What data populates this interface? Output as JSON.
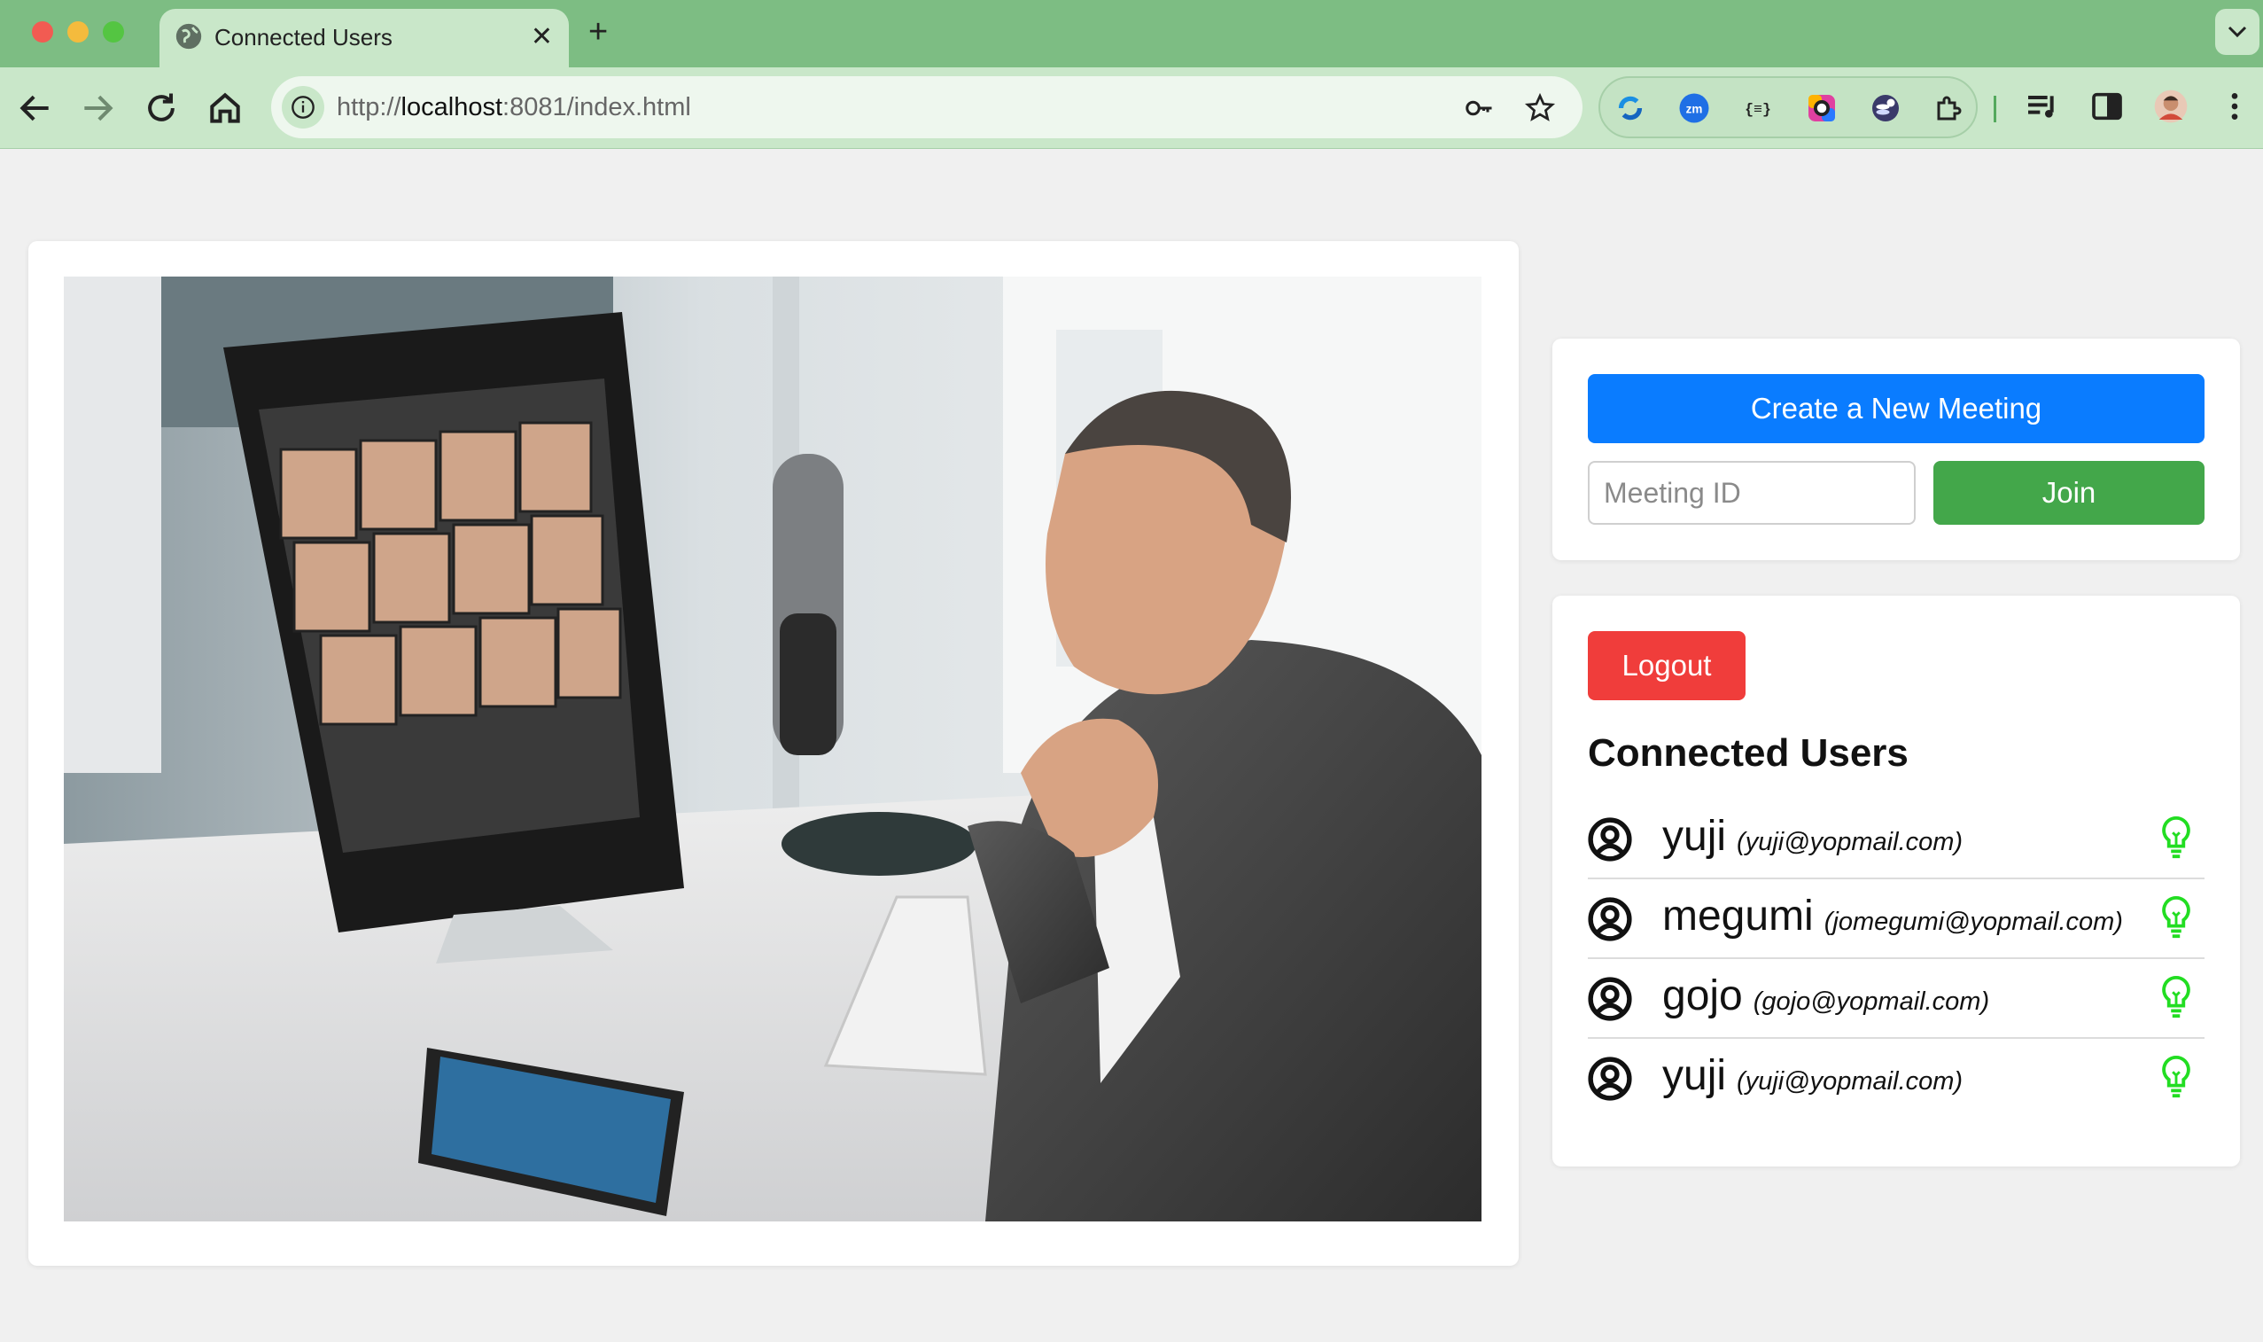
{
  "browser": {
    "tab_title": "Connected Users",
    "url_prefix": "http://",
    "url_host": "localhost",
    "url_rest": ":8081/index.html",
    "ext_zoom_label": "zm",
    "ext_json_label": "{≡}"
  },
  "meeting": {
    "create_label": "Create a New Meeting",
    "meeting_id_placeholder": "Meeting ID",
    "meeting_id_value": "",
    "join_label": "Join"
  },
  "users_panel": {
    "logout_label": "Logout",
    "title": "Connected Users",
    "users": [
      {
        "name": "yuji",
        "email": "(yuji@yopmail.com)",
        "status": "online"
      },
      {
        "name": "megumi",
        "email": "(jomegumi@yopmail.com)",
        "status": "online"
      },
      {
        "name": "gojo",
        "email": "(gojo@yopmail.com)",
        "status": "online"
      },
      {
        "name": "yuji",
        "email": "(yuji@yopmail.com)",
        "status": "online"
      }
    ]
  },
  "colors": {
    "chrome_green": "#7dbd83",
    "create_button": "#0a7cff",
    "join_button": "#43a74a",
    "logout_button": "#f03d3b",
    "online_bulb": "#22dd22"
  },
  "hero_image": {
    "description_icon": "video-call-photo"
  }
}
